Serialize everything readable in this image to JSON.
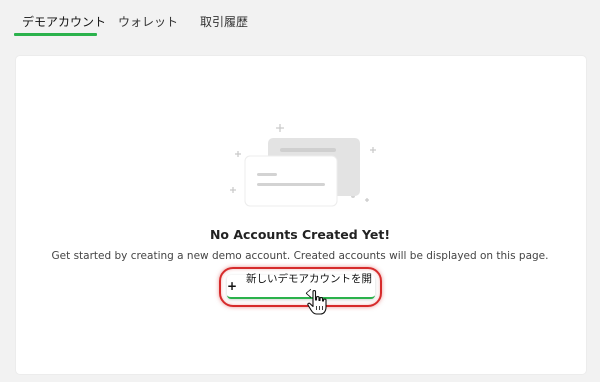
{
  "tabs": [
    {
      "label": "デモアカウント",
      "active": true
    },
    {
      "label": "ウォレット",
      "active": false
    },
    {
      "label": "取引履歴",
      "active": false
    }
  ],
  "empty_state": {
    "title": "No Accounts Created Yet!",
    "description": "Get started by creating a new demo account. Created accounts will be displayed on this page.",
    "illustration_icon": "stacked-cards-illustration"
  },
  "open_button": {
    "icon": "plus-icon",
    "label": "新しいデモアカウントを開く"
  },
  "colors": {
    "accent_green": "#2bb24c",
    "highlight_red": "#d62b2b",
    "page_bg": "#f2f2f2",
    "panel_bg": "#ffffff"
  }
}
